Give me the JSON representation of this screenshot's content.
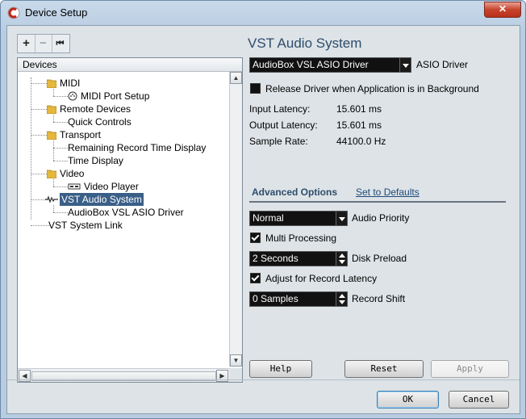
{
  "window": {
    "title": "Device Setup",
    "close_label": "✕"
  },
  "toolbar": {
    "add_label": "+",
    "remove_label": "−",
    "reset_label": "⏮"
  },
  "tree": {
    "header": "Devices",
    "items": [
      {
        "label": "MIDI"
      },
      {
        "label": "MIDI Port Setup"
      },
      {
        "label": "Remote Devices"
      },
      {
        "label": "Quick Controls"
      },
      {
        "label": "Transport"
      },
      {
        "label": "Remaining Record Time Display"
      },
      {
        "label": "Time Display"
      },
      {
        "label": "Video"
      },
      {
        "label": "Video Player"
      },
      {
        "label": "VST Audio System"
      },
      {
        "label": "AudioBox VSL ASIO Driver"
      },
      {
        "label": "VST System Link"
      }
    ],
    "selected": "VST Audio System"
  },
  "panel": {
    "title": "VST Audio System",
    "driver": {
      "value": "AudioBox VSL ASIO Driver",
      "label": "ASIO Driver"
    },
    "release_driver": {
      "label": "Release Driver when Application is in Background",
      "checked": false
    },
    "input_latency": {
      "label": "Input Latency:",
      "value": "15.601 ms"
    },
    "output_latency": {
      "label": "Output Latency:",
      "value": "15.601 ms"
    },
    "sample_rate": {
      "label": "Sample Rate:",
      "value": "44100.0 Hz"
    },
    "advanced": {
      "title": "Advanced Options",
      "set_defaults": "Set to Defaults",
      "audio_priority": {
        "value": "Normal",
        "label": "Audio Priority"
      },
      "multi_processing": {
        "label": "Multi Processing",
        "checked": true
      },
      "disk_preload": {
        "value": "2 Seconds",
        "label": "Disk Preload"
      },
      "adjust_latency": {
        "label": "Adjust for Record Latency",
        "checked": true
      },
      "record_shift": {
        "value": "0 Samples",
        "label": "Record Shift"
      }
    }
  },
  "buttons": {
    "help": "Help",
    "reset": "Reset",
    "apply": "Apply",
    "ok": "OK",
    "cancel": "Cancel"
  },
  "colors": {
    "title_blue": "#2e4d6b",
    "selection": "#3a5f87",
    "close_red": "#c7432c"
  }
}
